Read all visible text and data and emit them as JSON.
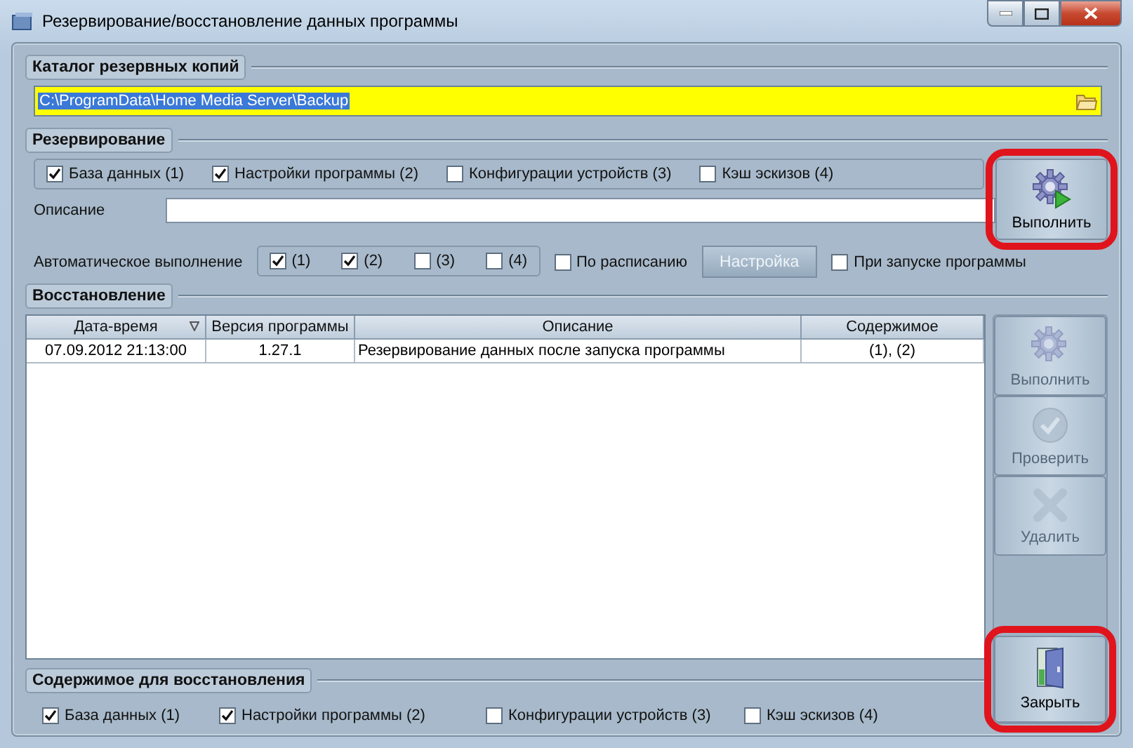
{
  "window": {
    "title": "Резервирование/восстановление данных программы"
  },
  "catalog": {
    "legend": "Каталог резервных копий",
    "path": "C:\\ProgramData\\Home Media Server\\Backup",
    "path_selected": true
  },
  "backup": {
    "legend": "Резервирование",
    "items": [
      {
        "label": "База данных (1)",
        "checked": true
      },
      {
        "label": "Настройки программы  (2)",
        "checked": true
      },
      {
        "label": "Конфигурации устройств (3)",
        "checked": false
      },
      {
        "label": "Кэш эскизов (4)",
        "checked": false
      }
    ],
    "description_label": "Описание",
    "run_button": {
      "label": "Выполнить",
      "disabled": false,
      "highlighted": true
    },
    "auto": {
      "label": "Автоматическое выполнение",
      "options": [
        {
          "label": "(1)",
          "checked": true
        },
        {
          "label": "(2)",
          "checked": true
        },
        {
          "label": "(3)",
          "checked": false
        },
        {
          "label": "(4)",
          "checked": false
        }
      ]
    },
    "schedule": {
      "label": "По расписанию",
      "checked": false
    },
    "settings_button": {
      "label": "Настройка",
      "disabled": true
    },
    "on_start": {
      "label": "При запуске программы",
      "checked": false
    }
  },
  "restore": {
    "legend": "Восстановление",
    "columns": [
      {
        "label": "Дата-время",
        "sorted": true
      },
      {
        "label": "Версия программы",
        "sorted": false
      },
      {
        "label": "Описание",
        "sorted": false
      },
      {
        "label": "Содержимое",
        "sorted": false
      }
    ],
    "rows": [
      {
        "cells": [
          "07.09.2012 21:13:00",
          "1.27.1",
          "Резервирование данных после запуска программы",
          "(1), (2)"
        ],
        "selected": false
      }
    ],
    "actions": [
      {
        "kind": "run",
        "label": "Выполнить",
        "disabled": true,
        "highlighted": false
      },
      {
        "kind": "check",
        "label": "Проверить",
        "disabled": true,
        "highlighted": false
      },
      {
        "kind": "delete",
        "label": "Удалить",
        "disabled": true,
        "highlighted": false
      }
    ],
    "close_button": {
      "label": "Закрыть",
      "disabled": false,
      "highlighted": true
    }
  },
  "contents": {
    "legend": "Содержимое для восстановления",
    "items": [
      {
        "label": "База данных (1)",
        "checked": true
      },
      {
        "label": "Настройки программы  (2)",
        "checked": true
      },
      {
        "label": "Конфигурации устройств (3)",
        "checked": false
      },
      {
        "label": "Кэш эскизов (4)",
        "checked": false
      }
    ]
  }
}
